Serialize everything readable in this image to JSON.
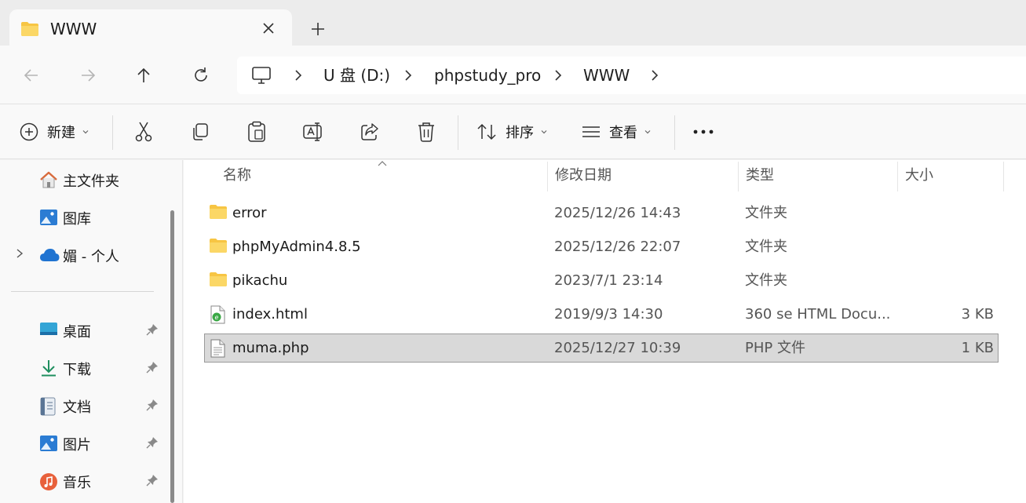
{
  "tab": {
    "title": "WWW",
    "close_icon": "close-icon",
    "new_tab_icon": "plus-icon"
  },
  "nav": {
    "back_icon": "arrow-left-icon",
    "forward_icon": "arrow-right-icon",
    "up_icon": "arrow-up-icon",
    "refresh_icon": "refresh-icon"
  },
  "address": {
    "root_icon": "computer-icon",
    "crumbs": [
      "U 盘 (D:)",
      "phpstudy_pro",
      "WWW"
    ]
  },
  "toolbar": {
    "new_label": "新建",
    "sort_label": "排序",
    "view_label": "查看",
    "icons": [
      "cut-icon",
      "copy-icon",
      "paste-icon",
      "rename-icon",
      "share-icon",
      "delete-icon",
      "more-icon"
    ]
  },
  "sidebar": {
    "items": [
      {
        "label": "主文件夹",
        "icon": "home-icon"
      },
      {
        "label": "图库",
        "icon": "gallery-icon"
      },
      {
        "label": "媚 - 个人",
        "icon": "onedrive-cloud-icon"
      },
      {
        "label": "桌面",
        "icon": "desktop-icon",
        "pinned": true
      },
      {
        "label": "下载",
        "icon": "download-icon",
        "pinned": true
      },
      {
        "label": "文档",
        "icon": "documents-icon",
        "pinned": true
      },
      {
        "label": "图片",
        "icon": "pictures-icon",
        "pinned": true
      },
      {
        "label": "音乐",
        "icon": "music-icon",
        "pinned": true
      }
    ]
  },
  "columns": {
    "name": "名称",
    "date": "修改日期",
    "type": "类型",
    "size": "大小"
  },
  "files": [
    {
      "name": "error",
      "date": "2025/12/26 14:43",
      "type": "文件夹",
      "size": "",
      "icon": "folder-icon"
    },
    {
      "name": "phpMyAdmin4.8.5",
      "date": "2025/12/26 22:07",
      "type": "文件夹",
      "size": "",
      "icon": "folder-icon"
    },
    {
      "name": "pikachu",
      "date": "2023/7/1 23:14",
      "type": "文件夹",
      "size": "",
      "icon": "folder-icon"
    },
    {
      "name": "index.html",
      "date": "2019/9/3 14:30",
      "type": "360 se HTML Docu...",
      "size": "3 KB",
      "icon": "html-file-icon"
    },
    {
      "name": "muma.php",
      "date": "2025/12/27 10:39",
      "type": "PHP 文件",
      "size": "1 KB",
      "icon": "text-file-icon",
      "selected": true
    }
  ],
  "colors": {
    "accent": "#0f6cbd",
    "folder": "#f7c543",
    "selected_row": "#d9d9d9"
  }
}
